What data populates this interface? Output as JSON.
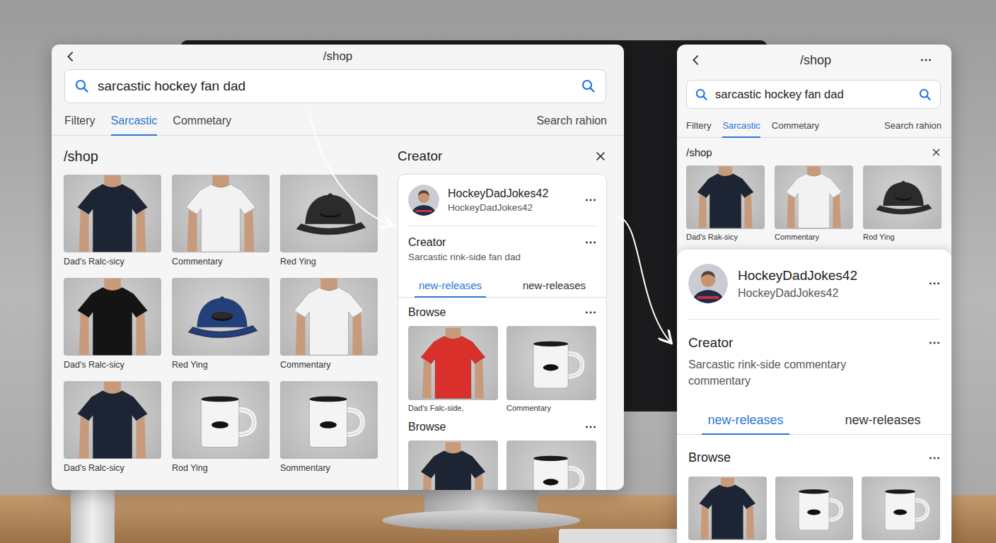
{
  "main_window": {
    "title": "/shop",
    "search": {
      "value": "sarcastic hockey fan dad"
    },
    "tabs": [
      {
        "label": "Filtery",
        "selected": false
      },
      {
        "label": "Sarcastic",
        "selected": true
      },
      {
        "label": "Commetary",
        "selected": false
      }
    ],
    "search_link": "Search rahion",
    "shop": {
      "heading": "/shop",
      "products": [
        {
          "kind": "shirt",
          "color": "#1d2433",
          "caption": "Dad's Ralc-sicy"
        },
        {
          "kind": "shirt",
          "color": "#f2f2f2",
          "caption": "Commentary"
        },
        {
          "kind": "cap",
          "color": "#2b2b2b",
          "caption": "Red Ying"
        },
        {
          "kind": "shirt",
          "color": "#141414",
          "caption": "Dad's Ralc-sicy"
        },
        {
          "kind": "cap",
          "color": "#24407a",
          "caption": "Red Ying"
        },
        {
          "kind": "shirt",
          "color": "#f2f2f2",
          "caption": "Commentary"
        },
        {
          "kind": "shirt",
          "color": "#1d2433",
          "caption": "Dad's Ralc-sicy"
        },
        {
          "kind": "mug",
          "color": "#f4f4f4",
          "caption": "Rod Ying"
        },
        {
          "kind": "mug",
          "color": "#f4f4f4",
          "caption": "Sommentary"
        }
      ]
    },
    "creator_panel": {
      "title": "Creator",
      "profile": {
        "name": "HockeyDadJokes42",
        "handle": "HockeyDadJokes42"
      },
      "section_title": "Creator",
      "bio": "Sarcastic rink-side fan dad",
      "tabs": [
        {
          "label": "new-releases",
          "selected": true
        },
        {
          "label": "new-releases",
          "selected": false
        }
      ],
      "browse": [
        {
          "title": "Browse",
          "products": [
            {
              "kind": "shirt",
              "color": "#d9302b",
              "caption": "Dad's Falc-side,"
            },
            {
              "kind": "mug",
              "color": "#f4f4f4",
              "caption": "Commentary"
            }
          ]
        },
        {
          "title": "Browse",
          "products": [
            {
              "kind": "shirt",
              "color": "#1d2433"
            },
            {
              "kind": "mug",
              "color": "#f4f4f4"
            }
          ]
        }
      ]
    }
  },
  "side_window": {
    "title": "/shop",
    "search": {
      "value": "sarcastic hockey fan dad"
    },
    "tabs": [
      {
        "label": "Filtery",
        "selected": false
      },
      {
        "label": "Sarcastic",
        "selected": true
      },
      {
        "label": "Commetary",
        "selected": false
      }
    ],
    "search_link": "Search rahion",
    "shop": {
      "heading": "/shop",
      "products": [
        {
          "kind": "shirt",
          "color": "#1d2433",
          "caption": "Dad's Rak-sicy"
        },
        {
          "kind": "shirt",
          "color": "#f2f2f2",
          "caption": "Commentary"
        },
        {
          "kind": "cap",
          "color": "#2b2b2b",
          "caption": "Rod Ying"
        }
      ]
    },
    "creator_sheet": {
      "profile": {
        "name": "HockeyDadJokes42",
        "handle": "HockeyDadJokes42"
      },
      "section_title": "Creator",
      "bio": "Sarcastic rink-side commentary commentary",
      "tabs": [
        {
          "label": "new-releases",
          "selected": true
        },
        {
          "label": "new-releases",
          "selected": false
        }
      ],
      "browse": {
        "title": "Browse",
        "products": [
          {
            "kind": "shirt",
            "color": "#1d2433"
          },
          {
            "kind": "mug",
            "color": "#f4f4f4"
          },
          {
            "kind": "mug",
            "color": "#f4f4f4"
          }
        ]
      }
    }
  }
}
